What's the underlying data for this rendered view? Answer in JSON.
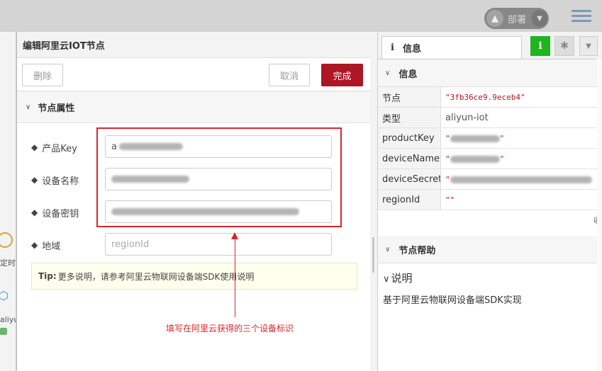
{
  "topbar": {
    "deploy_label": "部署"
  },
  "canvas": {
    "node1_label": "定时",
    "node2_label": "aliyu"
  },
  "tray": {
    "title": "编辑阿里云IOT节点",
    "delete_label": "删除",
    "cancel_label": "取消",
    "done_label": "完成",
    "section_title": "节点属性",
    "fields": [
      {
        "label": "产品Key",
        "value": "a[redacted]"
      },
      {
        "label": "设备名称",
        "value": "[redacted]"
      },
      {
        "label": "设备密钥",
        "value": "[redacted]"
      },
      {
        "label": "地域",
        "placeholder": "regionId"
      }
    ],
    "tip_bold": "Tip:",
    "tip_text": "更多说明，请参考阿里云物联网设备端SDK使用说明",
    "annotation": "填写在阿里云获得的三个设备标识"
  },
  "sidebar": {
    "tab_label": "信息",
    "info_icon": "info-icon",
    "debug_icon": "bug-icon",
    "info_section": "信息",
    "props": [
      {
        "key": "节点",
        "value": "\"3fb36ce9.9eceb4\""
      },
      {
        "key": "类型",
        "value": "aliyun-iot"
      },
      {
        "key": "productKey",
        "value": "\"[redacted]\""
      },
      {
        "key": "deviceName",
        "value": "\"[redacted]\""
      },
      {
        "key": "deviceSecret",
        "value": "\"[redacted]\""
      },
      {
        "key": "regionId",
        "value": "\"\""
      }
    ],
    "collapse_text": "收",
    "help_section": "节点帮助",
    "help_sub": "说明",
    "help_text": "基于阿里云物联网设备端SDK实现"
  },
  "colors": {
    "done_button": "#ad1625",
    "highlight_box": "#d9252c",
    "info_tab_active": "#1fb51f"
  }
}
